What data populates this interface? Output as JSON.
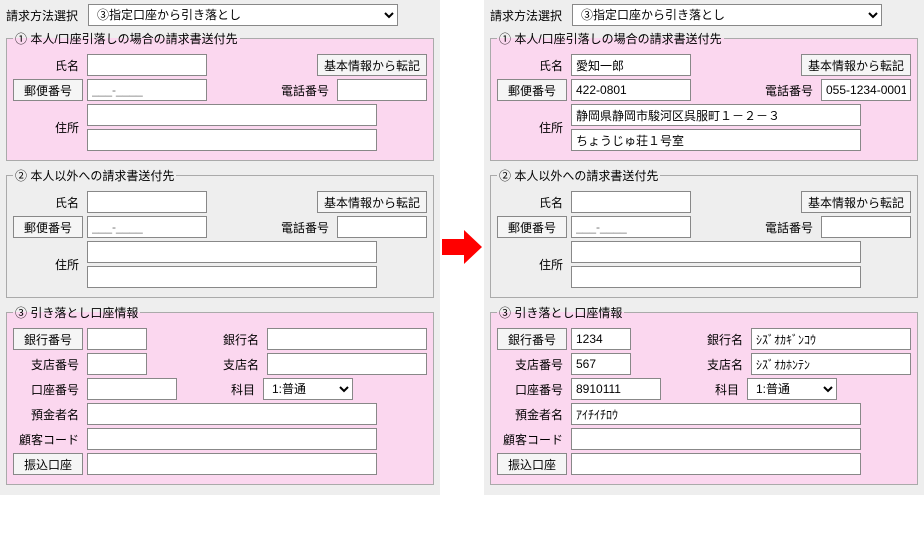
{
  "common": {
    "billing_method_label": "請求方法選択",
    "billing_method_value": "③指定口座から引き落とし",
    "group1_legend": "① 本人/口座引落しの場合の請求書送付先",
    "group2_legend": "② 本人以外への請求書送付先",
    "group3_legend": "③ 引き落とし口座情報",
    "labels": {
      "name": "氏名",
      "postal": "郵便番号",
      "phone": "電話番号",
      "address": "住所",
      "bank_no": "銀行番号",
      "bank_name": "銀行名",
      "branch_no": "支店番号",
      "branch_name": "支店名",
      "account_no": "口座番号",
      "kamoku": "科目",
      "holder": "預金者名",
      "customer_code": "顧客コード",
      "transfer_account": "振込口座"
    },
    "buttons": {
      "copy_basic": "基本情報から転記",
      "postal": "郵便番号",
      "bank_no": "銀行番号",
      "transfer_account": "振込口座"
    },
    "kamoku_value": "1:普通",
    "postal_placeholder": "___-____"
  },
  "left": {
    "g1": {
      "name": "",
      "postal": "",
      "phone": "",
      "addr1": "",
      "addr2": ""
    },
    "g2": {
      "name": "",
      "postal": "",
      "phone": "",
      "addr1": "",
      "addr2": ""
    },
    "g3": {
      "bank_no": "",
      "bank_name": "",
      "branch_no": "",
      "branch_name": "",
      "account_no": "",
      "holder": "",
      "customer_code": "",
      "transfer_account": ""
    }
  },
  "right": {
    "g1": {
      "name": "愛知一郎",
      "postal": "422-0801",
      "phone": "055-1234-0001",
      "addr1": "静岡県静岡市駿河区呉服町１－２－３",
      "addr2": "ちょうじゅ荘１号室"
    },
    "g2": {
      "name": "",
      "postal": "",
      "phone": "",
      "addr1": "",
      "addr2": ""
    },
    "g3": {
      "bank_no": "1234",
      "bank_name": "ｼｽﾞｵｶｷﾞﾝｺｳ",
      "branch_no": "567",
      "branch_name": "ｼｽﾞｵｶﾎﾝﾃﾝ",
      "account_no": "8910111",
      "holder": "ｱｲﾁｲﾁﾛｳ",
      "customer_code": "",
      "transfer_account": ""
    }
  }
}
